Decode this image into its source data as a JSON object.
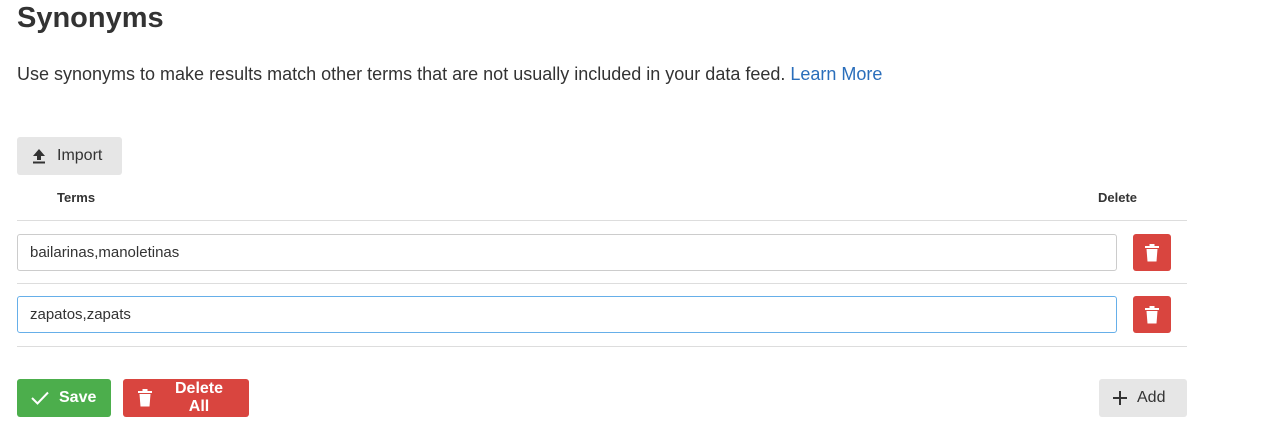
{
  "page": {
    "title": "Synonyms",
    "description": "Use synonyms to make results match other terms that are not usually included in your data feed.",
    "learn_more": "Learn More"
  },
  "toolbar": {
    "import_label": "Import"
  },
  "table": {
    "headers": {
      "terms": "Terms",
      "delete": "Delete"
    },
    "rows": [
      {
        "value": "bailarinas,manoletinas"
      },
      {
        "value": "zapatos,zapats"
      }
    ]
  },
  "footer": {
    "save_label": "Save",
    "delete_all_label": "Delete All",
    "add_label": "Add"
  },
  "colors": {
    "save": "#4cae4c",
    "danger": "#d9453f",
    "link": "#2a6ebb",
    "neutral_button": "#e6e6e6"
  },
  "icons": {
    "import": "upload-icon",
    "save": "checkmark-icon",
    "delete": "trash-icon",
    "add": "plus-icon"
  }
}
